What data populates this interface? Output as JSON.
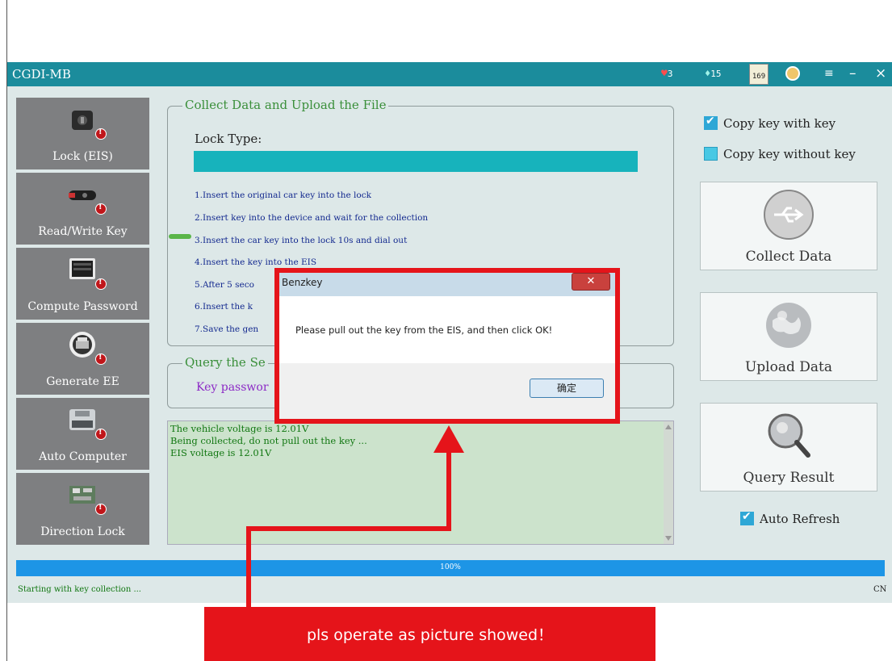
{
  "window": {
    "title": "CGDI-MB",
    "toolbar": {
      "hearts": "3",
      "gems": "15",
      "calendar": "169"
    }
  },
  "sidebar": {
    "items": [
      {
        "label": "Lock (EIS)",
        "icon": "lock-icon"
      },
      {
        "label": "Read/Write Key",
        "icon": "car-key-icon"
      },
      {
        "label": "Compute Password",
        "icon": "computer-icon"
      },
      {
        "label": "Generate EE",
        "icon": "printer-icon"
      },
      {
        "label": "Auto Computer",
        "icon": "ecu-icon"
      },
      {
        "label": "Direction Lock",
        "icon": "circuit-board-icon"
      }
    ]
  },
  "collect_group": {
    "legend": "Collect Data and Upload the File",
    "lock_type_label": "Lock Type:",
    "steps": [
      "1.Insert the original car key into the lock",
      "2.Insert key into the device and wait for the collection",
      "3.Insert the car key into the lock 10s and dial out",
      "4.Insert the key into the EIS",
      "5.After 5 seco",
      "6.Insert the k",
      "7.Save the gen"
    ]
  },
  "query_group": {
    "legend": "Query the Se",
    "key_password_label": "Key passwor"
  },
  "log": {
    "lines": [
      "The vehicle voltage is 12.01V",
      "Being collected, do not pull out the key ...",
      "EIS voltage is 12.01V"
    ]
  },
  "options": {
    "copy_with_key": "Copy key with key",
    "copy_without_key": "Copy key without key",
    "auto_refresh": "Auto Refresh"
  },
  "actions": {
    "collect": "Collect Data",
    "upload": "Upload  Data",
    "query": "Query Result"
  },
  "progress": {
    "value": 1.0,
    "label": "100%"
  },
  "status": {
    "text": "Starting with key collection ...",
    "lang": "CN"
  },
  "dialog": {
    "title": "Benzkey",
    "message": "Please pull out the key from the EIS, and then click OK!",
    "ok": "确定"
  },
  "banner": {
    "text": "pls operate as picture showed！"
  },
  "colors": {
    "titlebar": "#1b8c9c",
    "accent_red": "#e5141a",
    "progress": "#1d95e6",
    "teal_bar": "#17b3bc"
  }
}
